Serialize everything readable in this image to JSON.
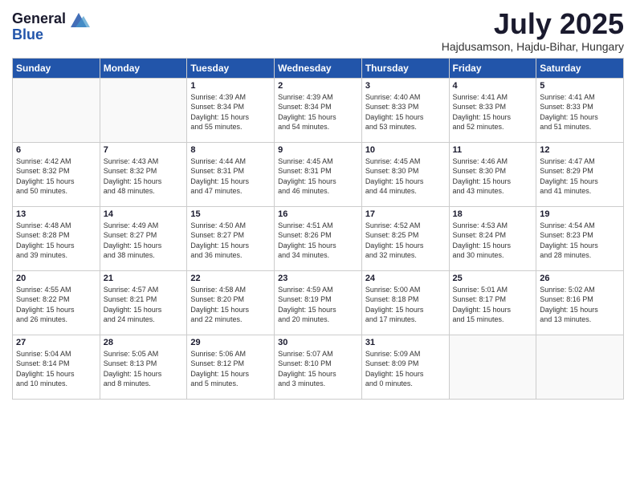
{
  "header": {
    "logo_general": "General",
    "logo_blue": "Blue",
    "month_title": "July 2025",
    "location": "Hajdusamson, Hajdu-Bihar, Hungary"
  },
  "days_of_week": [
    "Sunday",
    "Monday",
    "Tuesday",
    "Wednesday",
    "Thursday",
    "Friday",
    "Saturday"
  ],
  "weeks": [
    [
      {
        "day": "",
        "info": ""
      },
      {
        "day": "",
        "info": ""
      },
      {
        "day": "1",
        "info": "Sunrise: 4:39 AM\nSunset: 8:34 PM\nDaylight: 15 hours\nand 55 minutes."
      },
      {
        "day": "2",
        "info": "Sunrise: 4:39 AM\nSunset: 8:34 PM\nDaylight: 15 hours\nand 54 minutes."
      },
      {
        "day": "3",
        "info": "Sunrise: 4:40 AM\nSunset: 8:33 PM\nDaylight: 15 hours\nand 53 minutes."
      },
      {
        "day": "4",
        "info": "Sunrise: 4:41 AM\nSunset: 8:33 PM\nDaylight: 15 hours\nand 52 minutes."
      },
      {
        "day": "5",
        "info": "Sunrise: 4:41 AM\nSunset: 8:33 PM\nDaylight: 15 hours\nand 51 minutes."
      }
    ],
    [
      {
        "day": "6",
        "info": "Sunrise: 4:42 AM\nSunset: 8:32 PM\nDaylight: 15 hours\nand 50 minutes."
      },
      {
        "day": "7",
        "info": "Sunrise: 4:43 AM\nSunset: 8:32 PM\nDaylight: 15 hours\nand 48 minutes."
      },
      {
        "day": "8",
        "info": "Sunrise: 4:44 AM\nSunset: 8:31 PM\nDaylight: 15 hours\nand 47 minutes."
      },
      {
        "day": "9",
        "info": "Sunrise: 4:45 AM\nSunset: 8:31 PM\nDaylight: 15 hours\nand 46 minutes."
      },
      {
        "day": "10",
        "info": "Sunrise: 4:45 AM\nSunset: 8:30 PM\nDaylight: 15 hours\nand 44 minutes."
      },
      {
        "day": "11",
        "info": "Sunrise: 4:46 AM\nSunset: 8:30 PM\nDaylight: 15 hours\nand 43 minutes."
      },
      {
        "day": "12",
        "info": "Sunrise: 4:47 AM\nSunset: 8:29 PM\nDaylight: 15 hours\nand 41 minutes."
      }
    ],
    [
      {
        "day": "13",
        "info": "Sunrise: 4:48 AM\nSunset: 8:28 PM\nDaylight: 15 hours\nand 39 minutes."
      },
      {
        "day": "14",
        "info": "Sunrise: 4:49 AM\nSunset: 8:27 PM\nDaylight: 15 hours\nand 38 minutes."
      },
      {
        "day": "15",
        "info": "Sunrise: 4:50 AM\nSunset: 8:27 PM\nDaylight: 15 hours\nand 36 minutes."
      },
      {
        "day": "16",
        "info": "Sunrise: 4:51 AM\nSunset: 8:26 PM\nDaylight: 15 hours\nand 34 minutes."
      },
      {
        "day": "17",
        "info": "Sunrise: 4:52 AM\nSunset: 8:25 PM\nDaylight: 15 hours\nand 32 minutes."
      },
      {
        "day": "18",
        "info": "Sunrise: 4:53 AM\nSunset: 8:24 PM\nDaylight: 15 hours\nand 30 minutes."
      },
      {
        "day": "19",
        "info": "Sunrise: 4:54 AM\nSunset: 8:23 PM\nDaylight: 15 hours\nand 28 minutes."
      }
    ],
    [
      {
        "day": "20",
        "info": "Sunrise: 4:55 AM\nSunset: 8:22 PM\nDaylight: 15 hours\nand 26 minutes."
      },
      {
        "day": "21",
        "info": "Sunrise: 4:57 AM\nSunset: 8:21 PM\nDaylight: 15 hours\nand 24 minutes."
      },
      {
        "day": "22",
        "info": "Sunrise: 4:58 AM\nSunset: 8:20 PM\nDaylight: 15 hours\nand 22 minutes."
      },
      {
        "day": "23",
        "info": "Sunrise: 4:59 AM\nSunset: 8:19 PM\nDaylight: 15 hours\nand 20 minutes."
      },
      {
        "day": "24",
        "info": "Sunrise: 5:00 AM\nSunset: 8:18 PM\nDaylight: 15 hours\nand 17 minutes."
      },
      {
        "day": "25",
        "info": "Sunrise: 5:01 AM\nSunset: 8:17 PM\nDaylight: 15 hours\nand 15 minutes."
      },
      {
        "day": "26",
        "info": "Sunrise: 5:02 AM\nSunset: 8:16 PM\nDaylight: 15 hours\nand 13 minutes."
      }
    ],
    [
      {
        "day": "27",
        "info": "Sunrise: 5:04 AM\nSunset: 8:14 PM\nDaylight: 15 hours\nand 10 minutes."
      },
      {
        "day": "28",
        "info": "Sunrise: 5:05 AM\nSunset: 8:13 PM\nDaylight: 15 hours\nand 8 minutes."
      },
      {
        "day": "29",
        "info": "Sunrise: 5:06 AM\nSunset: 8:12 PM\nDaylight: 15 hours\nand 5 minutes."
      },
      {
        "day": "30",
        "info": "Sunrise: 5:07 AM\nSunset: 8:10 PM\nDaylight: 15 hours\nand 3 minutes."
      },
      {
        "day": "31",
        "info": "Sunrise: 5:09 AM\nSunset: 8:09 PM\nDaylight: 15 hours\nand 0 minutes."
      },
      {
        "day": "",
        "info": ""
      },
      {
        "day": "",
        "info": ""
      }
    ]
  ]
}
